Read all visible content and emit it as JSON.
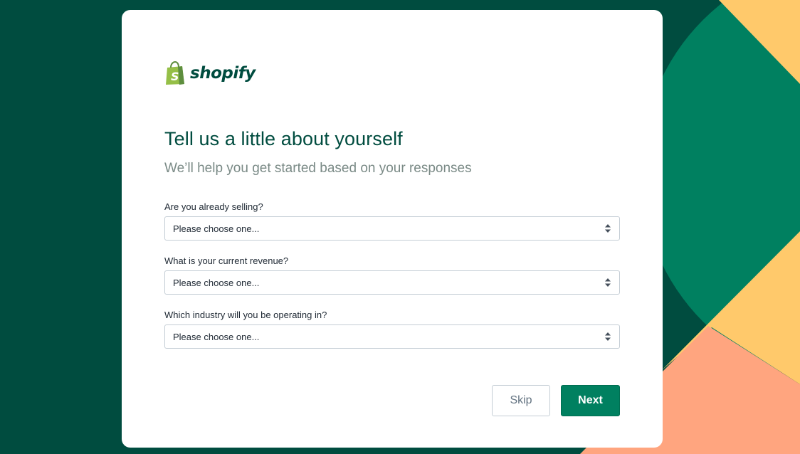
{
  "brand": {
    "name": "shopify",
    "logo_icon": "shopping-bag-icon"
  },
  "heading": {
    "title": "Tell us a little about yourself",
    "subtitle": "We’ll help you get started based on your responses"
  },
  "form": {
    "fields": [
      {
        "label": "Are you already selling?",
        "value": "Please choose one..."
      },
      {
        "label": "What is your current revenue?",
        "value": "Please choose one..."
      },
      {
        "label": "Which industry will you be operating in?",
        "value": "Please choose one..."
      }
    ]
  },
  "actions": {
    "skip_label": "Skip",
    "next_label": "Next"
  },
  "colors": {
    "background": "#004c3f",
    "accent": "#008060",
    "shape_green": "#008060",
    "shape_yellow": "#ffc96b",
    "shape_salmon": "#ffa57f"
  }
}
